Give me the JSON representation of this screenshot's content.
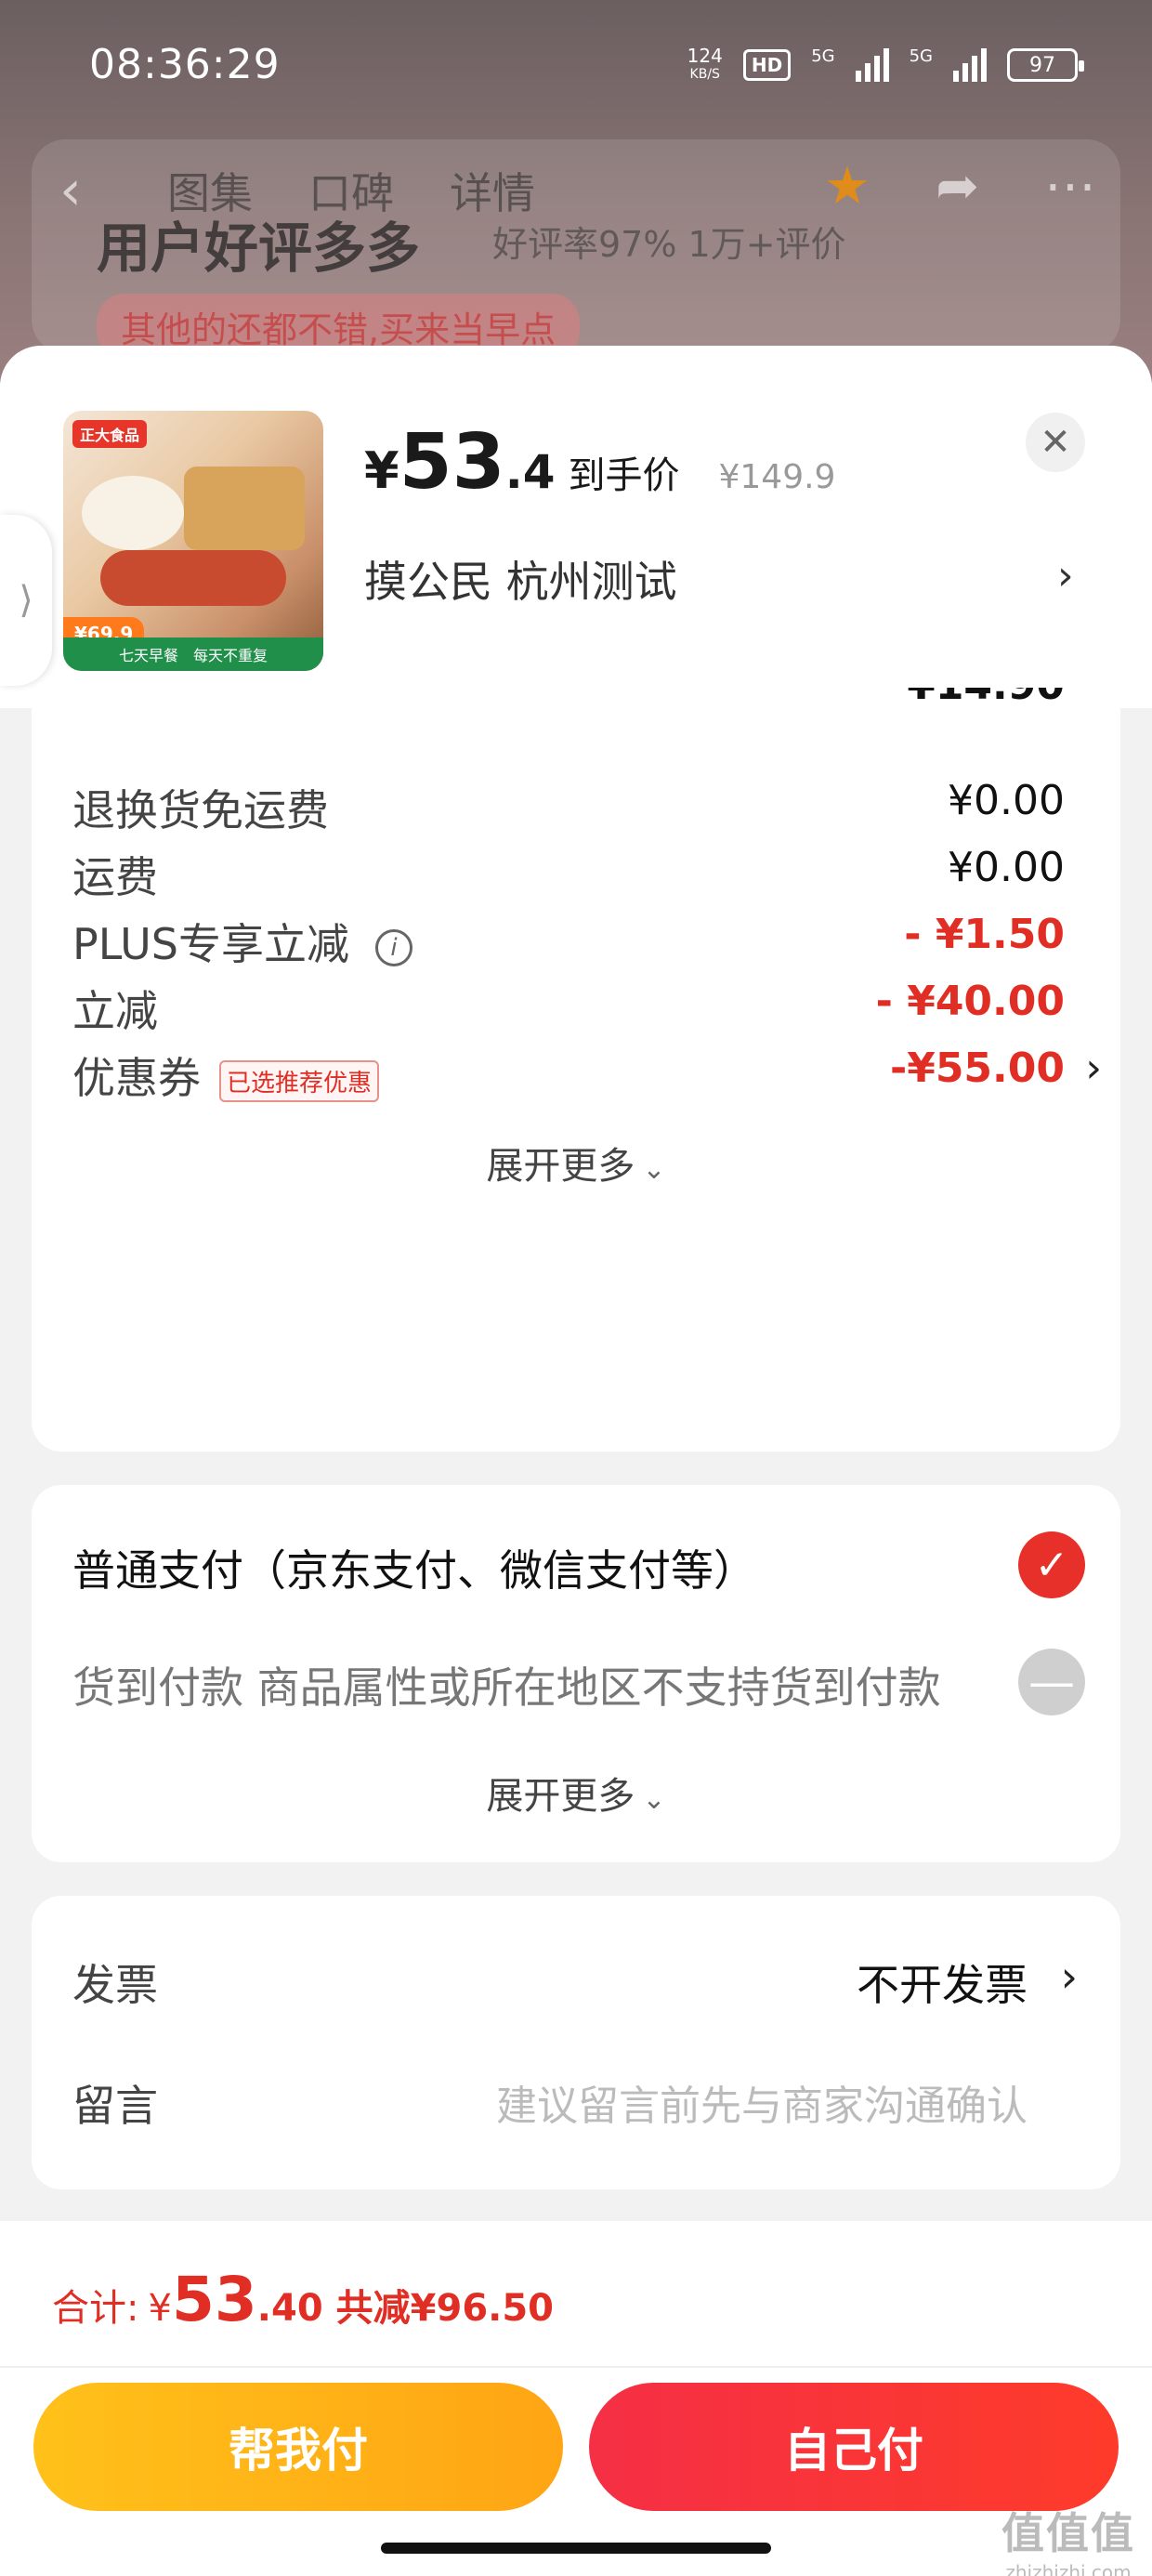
{
  "status_bar": {
    "time": "08:36:29",
    "net_speed_value": "124",
    "net_speed_unit": "KB/S",
    "hd_badge": "HD",
    "signal1_label": "5G",
    "signal2_label": "5G",
    "battery": "97"
  },
  "background_page": {
    "tabs": [
      "图集",
      "口碑",
      "详情"
    ],
    "reviews_title": "用户好评多多",
    "reviews_sub": "好评率97% 1万+评价",
    "review_chip": "其他的还都不错,买来当早点"
  },
  "product": {
    "thumb_logo": "正大食品",
    "thumb_price_tag": "¥69.9",
    "thumb_strip_left": "七天早餐",
    "thumb_strip_right": "每天不重复",
    "price_yen": "¥",
    "price_int": "53",
    "price_dec": ".4",
    "price_label": "到手价",
    "original_price": "¥149.9",
    "address": "摸公民  杭州测试"
  },
  "fees": {
    "rows": [
      {
        "label": "退换货免运费",
        "value": "¥0.00"
      },
      {
        "label": "运费",
        "value": "¥0.00"
      },
      {
        "label": "PLUS专享立减",
        "value": "- ¥1.50"
      },
      {
        "label": "立减",
        "value": "- ¥40.00"
      },
      {
        "label": "优惠券",
        "value": "-¥55.00",
        "tag": "已选推荐优惠"
      }
    ],
    "expand_label": "展开更多"
  },
  "payment": {
    "options": [
      {
        "label": "普通支付（京东支付、微信支付等）"
      },
      {
        "label": "货到付款 商品属性或所在地区不支持货到付款"
      }
    ],
    "expand_label": "展开更多"
  },
  "invoice": {
    "invoice_label": "发票",
    "invoice_value": "不开发票",
    "message_label": "留言",
    "message_placeholder": "建议留言前先与商家沟通确认"
  },
  "footer": {
    "total_label": "合计:",
    "total_yen": "¥",
    "total_int": "53",
    "total_dec": ".40",
    "saved": "共减¥96.50",
    "help_pay": "帮我付",
    "self_pay": "自己付"
  },
  "watermark": {
    "line1": "值值值",
    "line2": "zhizhizhi.com"
  },
  "colors": {
    "accent_red": "#e02e24",
    "help_button": "#ffb316",
    "self_button": "#f8323a"
  }
}
